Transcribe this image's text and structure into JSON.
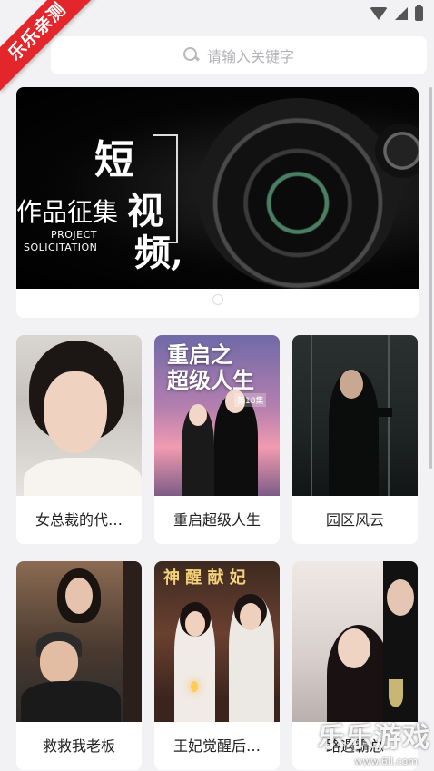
{
  "watermark": {
    "ribbon": "乐乐亲测",
    "brand": "乐乐游戏",
    "url": "www.6ll.com"
  },
  "search": {
    "placeholder": "请输入关键字"
  },
  "banner": {
    "title_char1": "短",
    "title_char2": "视",
    "title_char3": "频,",
    "works": "作品征集",
    "en_line1": "PROJECT",
    "en_line2": "SOLICITATION",
    "page_index": 1,
    "page_count": 1
  },
  "thumb_text": {
    "card2_title": "重启之\n超级人生",
    "card2_episode": "第18集",
    "card5_title": "神 醒 献 妃"
  },
  "dramas": [
    {
      "title": "女总裁的代…"
    },
    {
      "title": "重启超级人生"
    },
    {
      "title": "园区风云"
    },
    {
      "title": "救救我老板"
    },
    {
      "title": "王妃觉醒后…"
    },
    {
      "title": "路遇霸总"
    }
  ],
  "colors": {
    "accent_red": "#e3262b",
    "card_bg": "#ffffff",
    "page_bg": "#f2f2f4"
  }
}
